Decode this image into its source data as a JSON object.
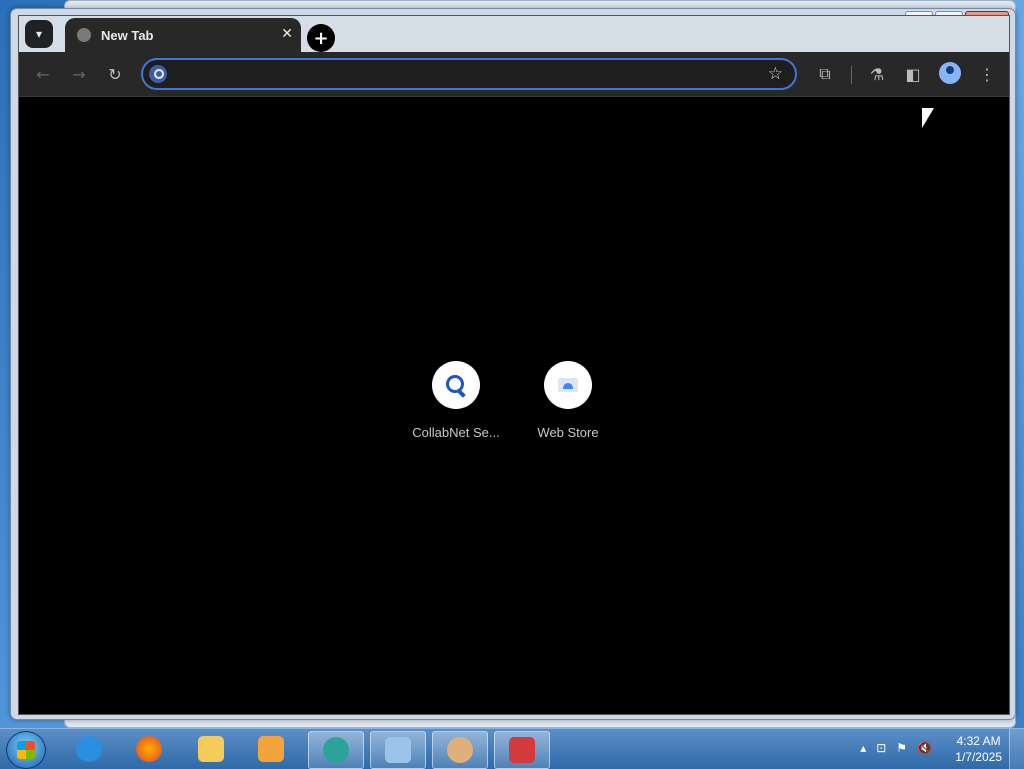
{
  "tab": {
    "title": "New Tab"
  },
  "omnibox": {
    "value": "",
    "placeholder": ""
  },
  "shortcuts": [
    {
      "label": "CollabNet Se...",
      "icon": "search-icon"
    },
    {
      "label": "Web Store",
      "icon": "web-store-icon"
    }
  ],
  "window_controls": {
    "minimize": "–",
    "maximize": "□",
    "close": "✕"
  },
  "taskbar": {
    "items": [
      "internet-explorer",
      "firefox",
      "file-explorer",
      "media-player",
      "active-app",
      "control-panel",
      "user-accounts",
      "toolbox"
    ]
  },
  "clock": {
    "time": "4:32 AM",
    "date": "1/7/2025"
  },
  "colors": {
    "accent": "#3c78d8",
    "toolbar": "#282828",
    "content": "#000000"
  }
}
